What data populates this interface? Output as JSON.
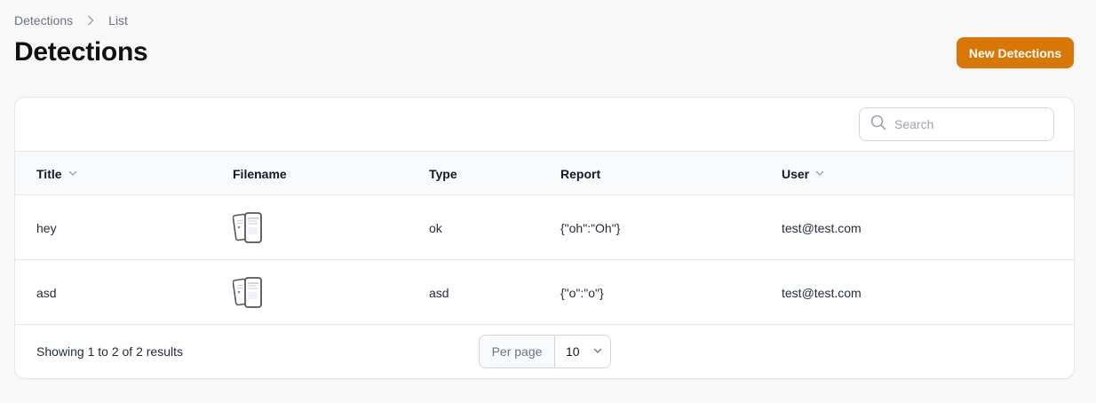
{
  "breadcrumb": {
    "items": [
      "Detections",
      "List"
    ]
  },
  "page": {
    "title": "Detections",
    "new_button_label": "New Detections"
  },
  "search": {
    "placeholder": "Search",
    "value": ""
  },
  "table": {
    "columns": [
      {
        "label": "Title",
        "sortable": true
      },
      {
        "label": "Filename",
        "sortable": false
      },
      {
        "label": "Type",
        "sortable": false
      },
      {
        "label": "Report",
        "sortable": false
      },
      {
        "label": "User",
        "sortable": true
      }
    ],
    "rows": [
      {
        "title": "hey",
        "filename_icon": "image-thumbnail-icon",
        "type": "ok",
        "report": "{\"oh\":\"Oh\"}",
        "user": "test@test.com"
      },
      {
        "title": "asd",
        "filename_icon": "image-thumbnail-icon",
        "type": "asd",
        "report": "{\"o\":\"o\"}",
        "user": "test@test.com"
      }
    ]
  },
  "footer": {
    "results_text": "Showing 1 to 2 of 2 results",
    "per_page_label": "Per page",
    "per_page_value": "10"
  },
  "colors": {
    "accent": "#d97706",
    "border": "#e5e7eb",
    "background": "#f8f8f8"
  }
}
